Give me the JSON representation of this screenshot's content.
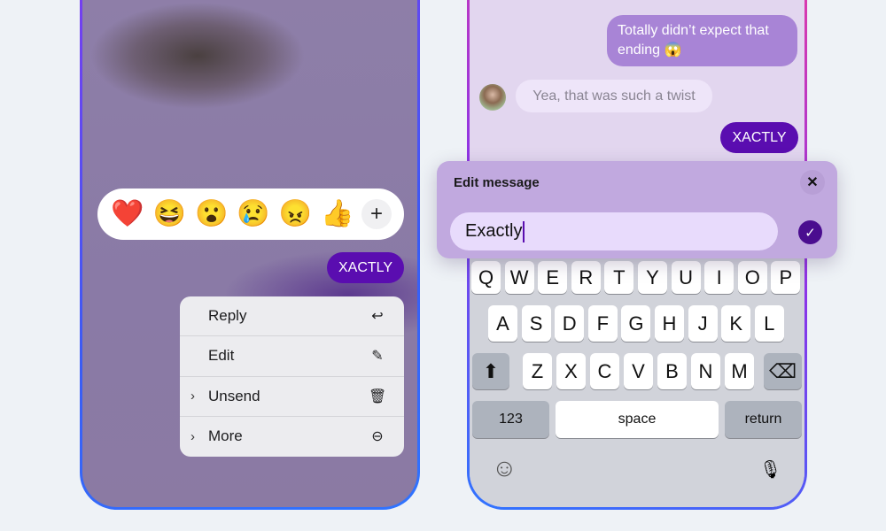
{
  "left_phone": {
    "reactions": [
      {
        "icon": "red-heart",
        "glyph": "❤️"
      },
      {
        "icon": "laughing-face",
        "glyph": "😆"
      },
      {
        "icon": "surprised-face",
        "glyph": "😮"
      },
      {
        "icon": "crying-face",
        "glyph": "😢"
      },
      {
        "icon": "angry-face",
        "glyph": "😠"
      },
      {
        "icon": "thumbs-up",
        "glyph": "👍"
      }
    ],
    "add_reaction": "+",
    "message": "XACTLY",
    "menu": [
      {
        "label": "Reply",
        "icon": "reply-icon",
        "glyph": "↩",
        "chevron": ""
      },
      {
        "label": "Edit",
        "icon": "pencil-icon",
        "glyph": "✎",
        "chevron": ""
      },
      {
        "label": "Unsend",
        "icon": "trash-icon",
        "glyph": "🗑",
        "chevron": "›"
      },
      {
        "label": "More",
        "icon": "more-circle-icon",
        "glyph": "⊖",
        "chevron": "›"
      }
    ]
  },
  "right_phone": {
    "messages": [
      {
        "from": "me",
        "text": "Totally didn’t expect that ending 😱"
      },
      {
        "from": "other",
        "text": "Yea, that was such a twist"
      },
      {
        "from": "me",
        "text": "XACTLY"
      }
    ],
    "edit_panel": {
      "title": "Edit message",
      "value": "Exactly",
      "close": "✕",
      "confirm": "✓"
    },
    "keyboard": {
      "row1": [
        "Q",
        "W",
        "E",
        "R",
        "T",
        "Y",
        "U",
        "I",
        "O",
        "P"
      ],
      "row2": [
        "A",
        "S",
        "D",
        "F",
        "G",
        "H",
        "J",
        "K",
        "L"
      ],
      "row3": [
        "Z",
        "X",
        "C",
        "V",
        "B",
        "N",
        "M"
      ],
      "shift": "⬆",
      "backspace": "⌫",
      "numbers": "123",
      "space": "space",
      "return": "return",
      "emoji": "☺",
      "mic": "🎙"
    }
  },
  "colors": {
    "sent_bubble": "#5a0db0",
    "light_sent": "#a884d6",
    "edit_panel": "#c1a9df",
    "input": "#e8dbfc"
  }
}
